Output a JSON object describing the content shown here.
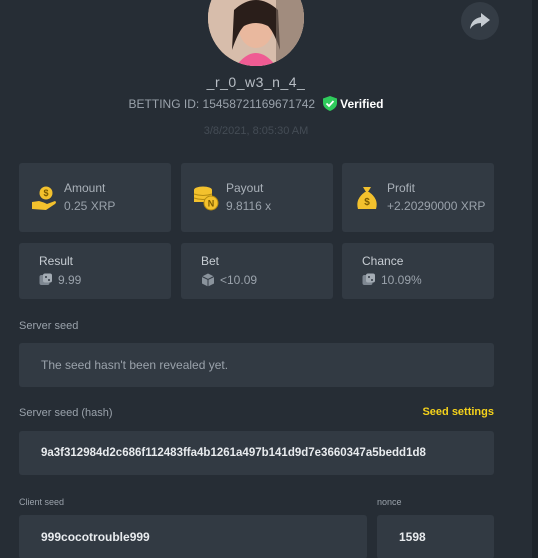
{
  "profile": {
    "username": "_r_0_w3_n_4_",
    "bet_id": "BETTING ID: 15458721169671742",
    "verified_label": "Verified",
    "timestamp": "3/8/2021, 8:05:30 AM"
  },
  "stats": {
    "amount": {
      "label": "Amount",
      "value": "0.25 XRP",
      "icon": "money-bag-hand-icon"
    },
    "payout": {
      "label": "Payout",
      "value": "9.8116 x",
      "icon": "coin-stack-icon"
    },
    "profit": {
      "label": "Profit",
      "value": "+2.20290000 XRP",
      "icon": "money-sack-icon"
    },
    "result": {
      "label": "Result",
      "value": "9.99",
      "icon": "dice-icon"
    },
    "bet": {
      "label": "Bet",
      "value": "<10.09",
      "icon": "cube-icon"
    },
    "chance": {
      "label": "Chance",
      "value": "10.09%",
      "icon": "dice-icon"
    }
  },
  "server_seed": {
    "label": "Server seed",
    "value": "The seed hasn't been revealed yet."
  },
  "server_seed_hash": {
    "label": "Server seed (hash)",
    "settings_link": "Seed settings",
    "value": "9a3f312984d2c686f112483ffa4b1261a497b141d9d7e3660347a5bedd1d8"
  },
  "client_seed": {
    "label": "Client seed",
    "value": "999cocotrouble999"
  },
  "nonce": {
    "label": "nonce",
    "value": "1598"
  },
  "colors": {
    "background": "#262d35",
    "card": "#323a43",
    "accent_yellow": "#f5d21b",
    "verified_green": "#2fcb5c",
    "icon_gold": "#f3c12d"
  }
}
